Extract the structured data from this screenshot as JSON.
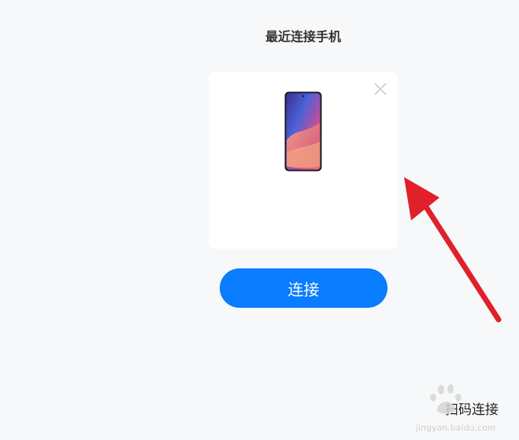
{
  "page": {
    "title": "最近连接手机"
  },
  "device_card": {
    "close_icon": "close-icon",
    "device_image": "phone-image"
  },
  "actions": {
    "connect_label": "连接",
    "qr_connect_label": "扫码连接"
  },
  "watermark": {
    "text": "jingyan.baidu.com"
  },
  "colors": {
    "background": "#f7f8fa",
    "card": "#ffffff",
    "primary": "#0a7cff",
    "annotation": "#e0202a"
  }
}
